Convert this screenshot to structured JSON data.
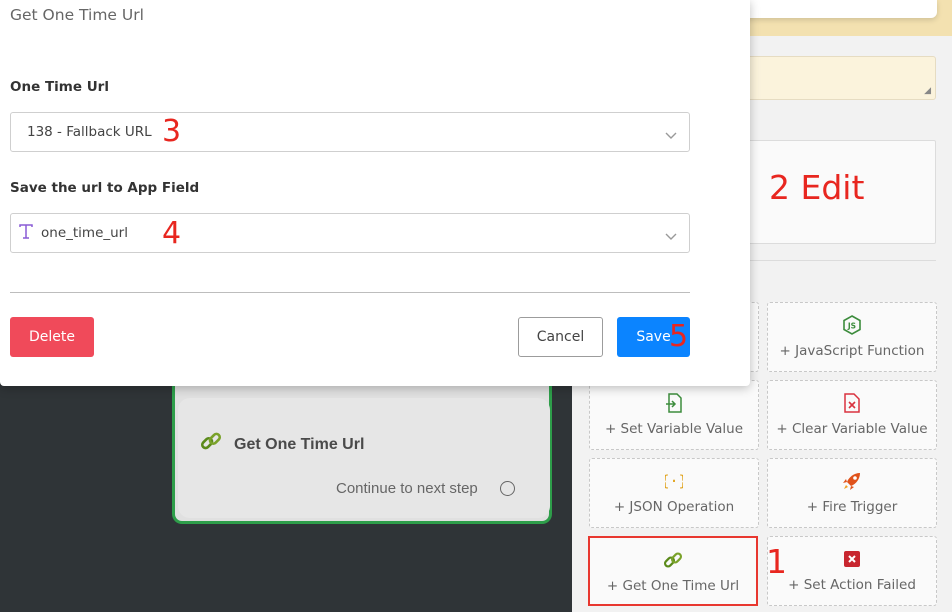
{
  "modal": {
    "title": "Get One Time Url",
    "one_time_url_label": "One Time Url",
    "one_time_url_value": "138 - Fallback URL",
    "save_to_label": "Save the url to App Field",
    "save_to_value": "one_time_url",
    "delete_label": "Delete",
    "cancel_label": "Cancel",
    "save_label": "Save"
  },
  "flow_node": {
    "title": "Get One Time Url",
    "continue_label": "Continue to next step"
  },
  "action_tiles": [
    {
      "label": "+ JavaScript Function",
      "icon": "js-icon",
      "color": "#3c8c3c"
    },
    {
      "label": "+ Set Variable Value",
      "icon": "file-import-icon",
      "color": "#3c8c3c"
    },
    {
      "label": "+ Clear Variable Value",
      "icon": "file-clear-icon",
      "color": "#d9333f"
    },
    {
      "label": "+ JSON Operation",
      "icon": "json-braces-icon",
      "color": "#e0a21a"
    },
    {
      "label": "+ Fire Trigger",
      "icon": "rocket-icon",
      "color": "#e0521a"
    },
    {
      "label": "+ Get One Time Url",
      "icon": "link-icon",
      "color": "#5a8a1a"
    },
    {
      "label": "+ Set Action Failed",
      "icon": "x-square-icon",
      "color": "#c8262f"
    }
  ],
  "annotations": {
    "a1": "1",
    "a2": "2 Edit",
    "a3": "3",
    "a4": "4",
    "a5": "5"
  },
  "colors": {
    "save": "#0b84ff",
    "delete": "#f04a5a",
    "node_border": "#2e9e4a",
    "annotation": "#e8261f"
  }
}
